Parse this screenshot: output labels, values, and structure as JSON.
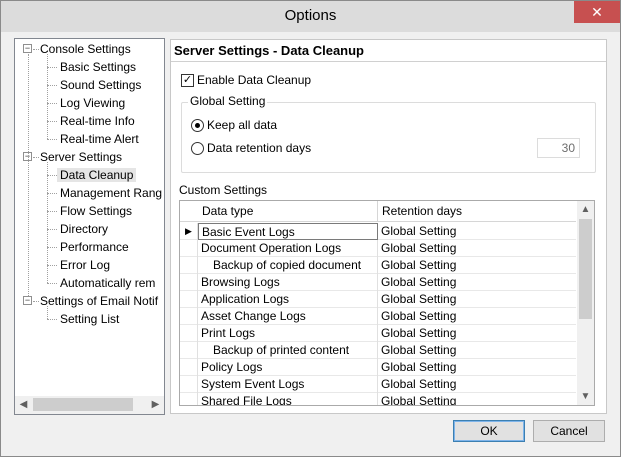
{
  "window": {
    "title": "Options",
    "close_glyph": "✕"
  },
  "tree": {
    "items": [
      {
        "label": "Console Settings",
        "level": 0,
        "expanded": true
      },
      {
        "label": "Basic Settings",
        "level": 1
      },
      {
        "label": "Sound Settings",
        "level": 1
      },
      {
        "label": "Log Viewing",
        "level": 1
      },
      {
        "label": "Real-time Info",
        "level": 1
      },
      {
        "label": "Real-time Alert",
        "level": 1
      },
      {
        "label": "Server Settings",
        "level": 0,
        "expanded": true
      },
      {
        "label": "Data Cleanup",
        "level": 1,
        "selected": true
      },
      {
        "label": "Management Rang",
        "level": 1
      },
      {
        "label": "Flow Settings",
        "level": 1
      },
      {
        "label": "Directory",
        "level": 1
      },
      {
        "label": "Performance",
        "level": 1
      },
      {
        "label": "Error Log",
        "level": 1
      },
      {
        "label": "Automatically rem",
        "level": 1
      },
      {
        "label": "Settings of Email Notif",
        "level": 0,
        "expanded": true
      },
      {
        "label": "Setting List",
        "level": 1
      }
    ],
    "expander_glyph": "−"
  },
  "panel": {
    "title": "Server Settings - Data Cleanup",
    "enable_cleanup": {
      "label": "Enable Data Cleanup",
      "checked": true,
      "glyph": "✓"
    },
    "global_setting": {
      "legend": "Global Setting",
      "keep_all": {
        "label": "Keep all data",
        "selected": true
      },
      "retention": {
        "label": "Data retention days",
        "selected": false,
        "value": "30"
      }
    },
    "custom_settings_label": "Custom Settings",
    "grid": {
      "columns": [
        "Data type",
        "Retention days"
      ],
      "current_marker": "▶",
      "rows": [
        {
          "type": "Basic Event Logs",
          "retention": "Global Setting",
          "sub": false,
          "current": true
        },
        {
          "type": "Document Operation Logs",
          "retention": "Global Setting",
          "sub": false
        },
        {
          "type": "Backup of copied document",
          "retention": "Global Setting",
          "sub": true
        },
        {
          "type": "Browsing Logs",
          "retention": "Global Setting",
          "sub": false
        },
        {
          "type": "Application Logs",
          "retention": "Global Setting",
          "sub": false
        },
        {
          "type": "Asset Change Logs",
          "retention": "Global Setting",
          "sub": false
        },
        {
          "type": "Print Logs",
          "retention": "Global Setting",
          "sub": false
        },
        {
          "type": "Backup of printed content",
          "retention": "Global Setting",
          "sub": true
        },
        {
          "type": "Policy Logs",
          "retention": "Global Setting",
          "sub": false
        },
        {
          "type": "System Event Logs",
          "retention": "Global Setting",
          "sub": false
        },
        {
          "type": "Shared File Logs",
          "retention": "Global Setting",
          "sub": false
        }
      ]
    }
  },
  "buttons": {
    "ok": "OK",
    "cancel": "Cancel"
  },
  "scroll_glyphs": {
    "up": "▲",
    "down": "▼",
    "left": "◀",
    "right": "▶"
  }
}
